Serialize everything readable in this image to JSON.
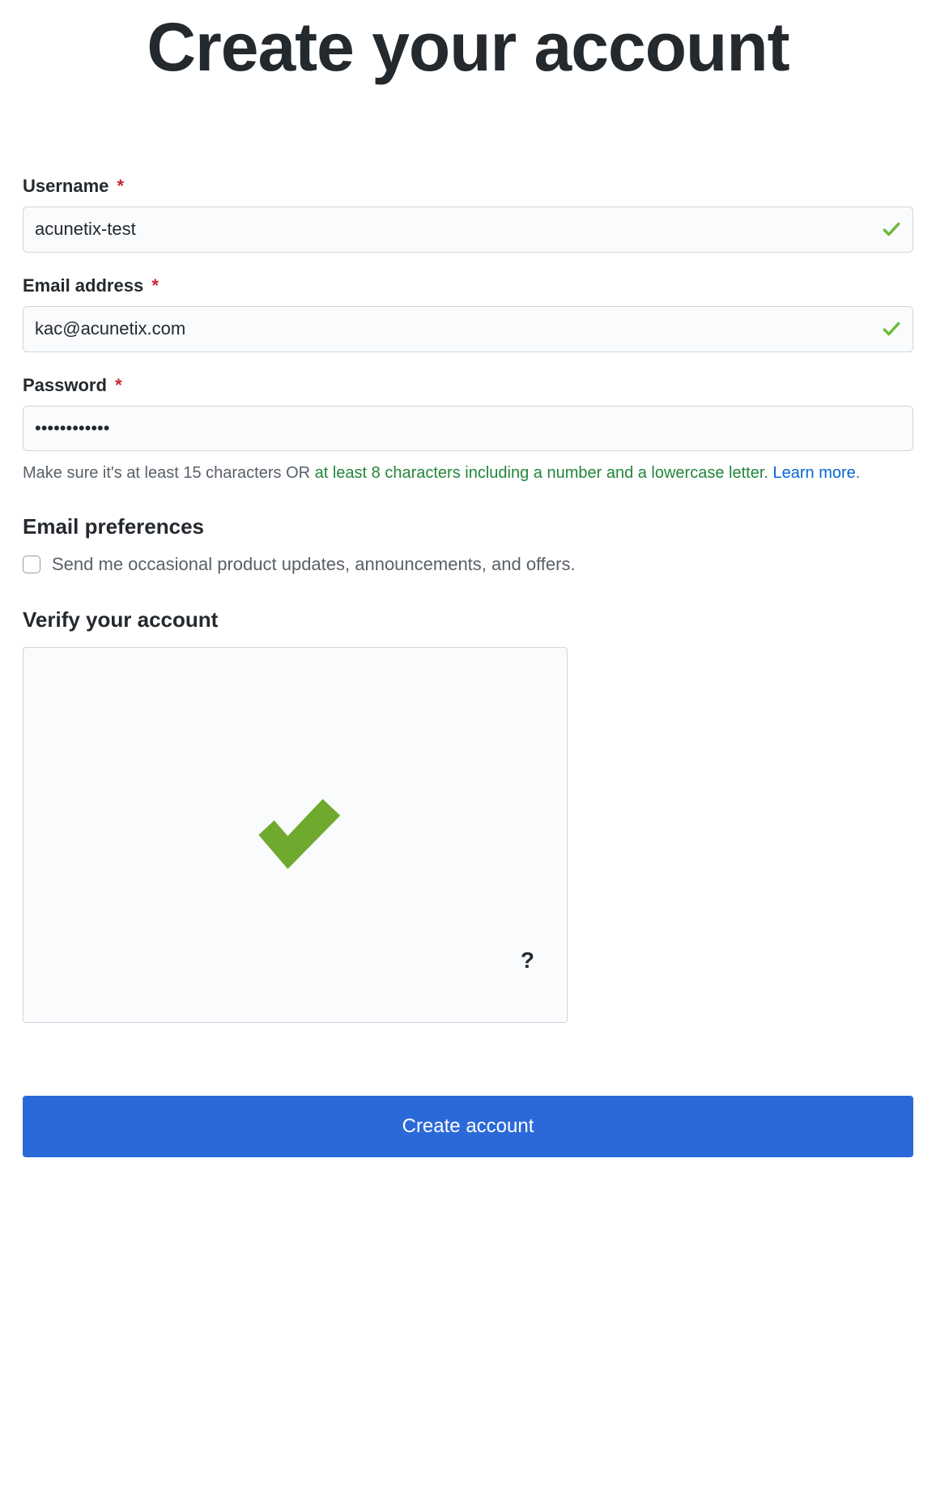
{
  "title": "Create your account",
  "fields": {
    "username": {
      "label": "Username",
      "value": "acunetix-test",
      "valid": true
    },
    "email": {
      "label": "Email address",
      "value": "kac@acunetix.com",
      "valid": true
    },
    "password": {
      "label": "Password",
      "value": "••••••••••••",
      "hint_plain": "Make sure it's at least 15 characters OR ",
      "hint_green": "at least 8 characters including a number and a lowercase letter",
      "hint_dot": ". ",
      "hint_link": "Learn more",
      "hint_tail": "."
    }
  },
  "email_prefs": {
    "heading": "Email preferences",
    "checkbox_label": "Send me occasional product updates, announcements, and offers."
  },
  "verify": {
    "heading": "Verify your account",
    "help": "?"
  },
  "submit_label": "Create account",
  "required_mark": "*"
}
